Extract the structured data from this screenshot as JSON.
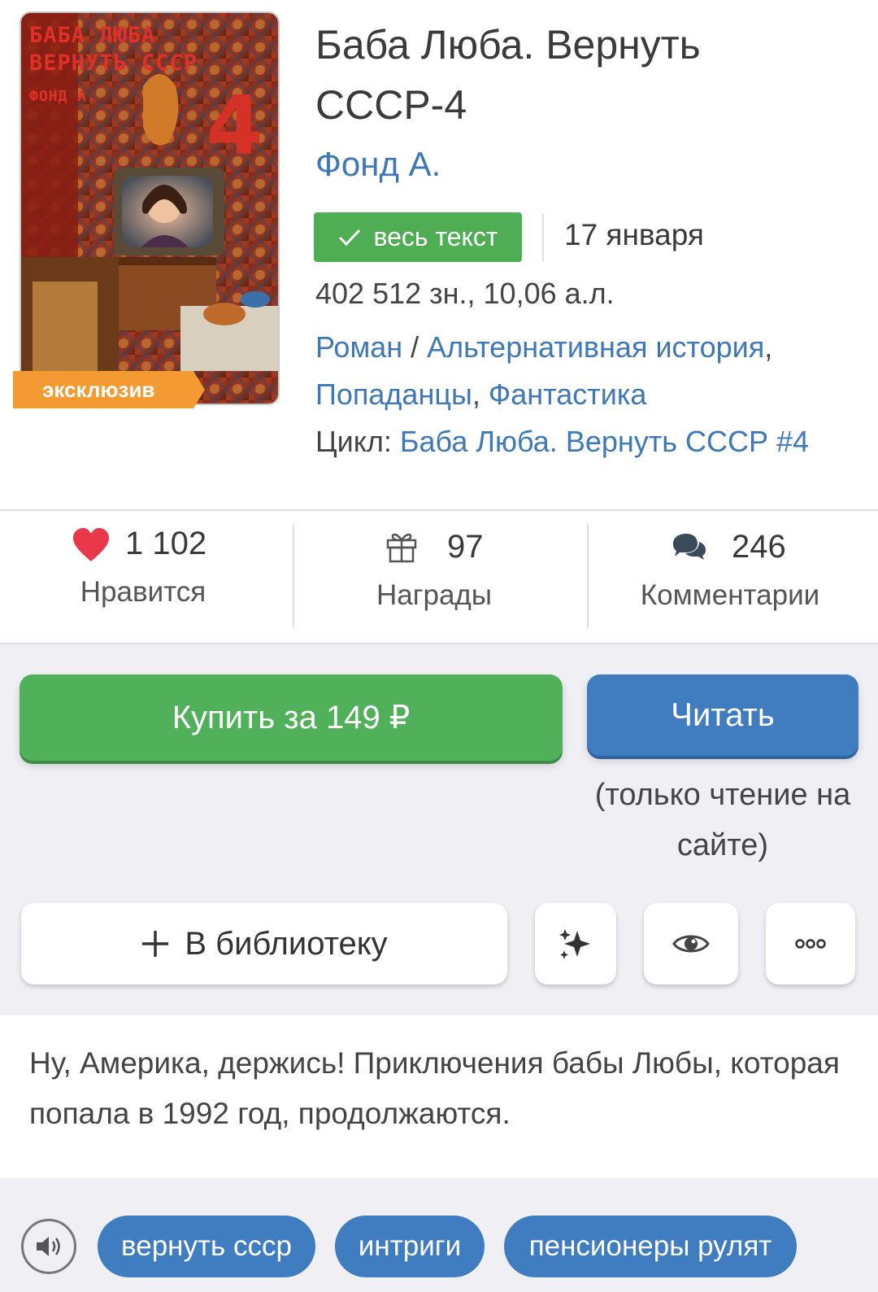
{
  "book": {
    "cover": {
      "line1": "БАБА ЛЮБА",
      "line2": "ВЕРНУТЬ СССР",
      "line3": "ФОНД А.",
      "number": "4",
      "badge": "эксклюзив"
    },
    "title": "Баба Люба. Вернуть СССР-4",
    "author": "Фонд А.",
    "status_badge": "весь текст",
    "date": "17 января",
    "size": "402 512 зн., 10,06 а.л.",
    "genre_main": "Роман",
    "genre_sep": " / ",
    "genres": [
      "Альтернативная история",
      "Попаданцы",
      "Фантастика"
    ],
    "genre_comma": ",",
    "cycle_label": "Цикл: ",
    "cycle_name": "Баба Люба. Вернуть СССР #4"
  },
  "stats": {
    "likes": {
      "value": "1 102",
      "label": "Нравится",
      "icon": "heart-icon"
    },
    "awards": {
      "value": "97",
      "label": "Награды",
      "icon": "gift-icon"
    },
    "comments": {
      "value": "246",
      "label": "Комментарии",
      "icon": "comments-icon"
    }
  },
  "actions": {
    "buy_label": "Купить за 149 ₽",
    "read_label": "Читать",
    "read_note": "(только чтение на сайте)",
    "library_label": "В библиотеку",
    "library_icon": "plus-icon",
    "sparkle_icon": "sparkle-icon",
    "watch_icon": "eye-icon",
    "more_icon": "more-icon"
  },
  "description": "Ну, Америка, держись! Приключения бабы Любы, которая попала в 1992 год, продолжаются.",
  "tags": [
    "вернуть ссср",
    "интриги",
    "пенсионеры рулят"
  ],
  "colors": {
    "green": "#51b05a",
    "blue": "#3f7cc0",
    "link": "#3e78b8",
    "orange": "#f39a32",
    "heart": "#e8384a",
    "background": "#efeff4"
  }
}
